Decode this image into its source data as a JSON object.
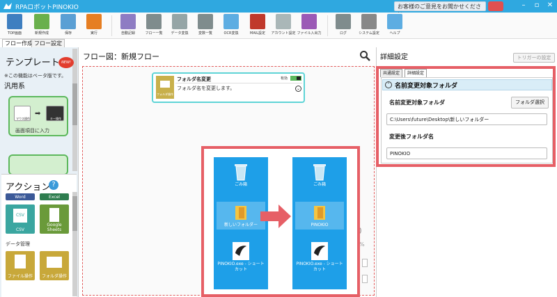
{
  "window": {
    "title": "RPAロボットPINOKIO",
    "feedback": "お客様のご意見をお聞かせください"
  },
  "ribbon": [
    {
      "label": "TOP画面",
      "color": "#3f7fc0",
      "icon": "home-icon"
    },
    {
      "label": "新規作成",
      "color": "#6ab04c",
      "icon": "new-file-icon"
    },
    {
      "label": "保存",
      "color": "#5a9fd4",
      "icon": "save-icon"
    },
    {
      "label": "実行",
      "color": "#e67e22",
      "icon": "play-icon"
    },
    {
      "label": "自動記録",
      "color": "#8e7cc3",
      "icon": "record-icon"
    },
    {
      "label": "フロー一覧",
      "color": "#7f8c8d",
      "icon": "list-icon"
    },
    {
      "label": "データ変換",
      "color": "#95a5a6",
      "icon": "database-icon"
    },
    {
      "label": "変数一覧",
      "color": "#7f8c8d",
      "icon": "variable-list-icon"
    },
    {
      "label": "OCR変換",
      "color": "#5dade2",
      "icon": "ocr-icon"
    },
    {
      "label": "MAIL設定",
      "color": "#c0392b",
      "icon": "mail-icon"
    },
    {
      "label": "アカウント設定",
      "color": "#aab7b8",
      "icon": "account-icon"
    },
    {
      "label": "ファイル入出力",
      "color": "#9b59b6",
      "icon": "file-io-icon"
    },
    {
      "label": "ログ",
      "color": "#7f8c8d",
      "icon": "log-icon"
    },
    {
      "label": "システム設定",
      "color": "#888888",
      "icon": "gear-icon"
    },
    {
      "label": "ヘルプ",
      "color": "#5dade2",
      "icon": "help-icon"
    }
  ],
  "tabs": {
    "flow_create": "フロー作成",
    "flow_settings": "フロー設定"
  },
  "left": {
    "template_title": "テンプレート",
    "new_badge": "NEW!",
    "beta_note": "※この機能はベータ版です。",
    "general_title": "汎用系",
    "card1_label": "画面項目に入力",
    "card1_sub1": "マウス操作",
    "card1_sub2": "キー操作",
    "action_title": "アクション",
    "action_help": "?",
    "tiles": {
      "word": "Word",
      "excel": "Excel",
      "csv": "CSV",
      "csv_icon": "CSV",
      "gsheets": "Google Sheets"
    },
    "data_mgmt": "データ管理",
    "tiles2": {
      "file_op": "ファイル操作",
      "folder_op": "フォルダ操作"
    }
  },
  "center": {
    "title": "フロー図：新規フロー",
    "node": {
      "icon_label": "フォルダ操作",
      "name": "フォルダ名変更",
      "enabled": "有効",
      "desc": "フォルダ名を変更します。"
    },
    "bg_zero": "0",
    "bg_pct": "%",
    "overlay": {
      "before": {
        "trash": "ごみ箱",
        "folder": "新しいフォルダー",
        "shortcut": "PINOKIO.exe - ショートカット"
      },
      "after": {
        "trash": "ごみ箱",
        "folder": "PINOKIO",
        "shortcut": "PINOKIO.exe - ショートカット"
      }
    }
  },
  "right": {
    "title": "詳細設定",
    "trigger_btn": "トリガーの設定",
    "tab_common": "共通設定",
    "tab_detail": "詳細設定",
    "section_title": "名前変更対象フォルダ",
    "target_label": "名前変更対象フォルダ",
    "select_btn": "フォルダ選択",
    "target_value": "C:\\Users\\future\\Desktop\\新しいフォルダー",
    "new_name_label": "変更後フォルダ名",
    "new_name_value": "PINOKIO"
  },
  "colors": {
    "accent": "#2fa8e0",
    "highlight": "#e65f66",
    "desktop": "#1e9fe8",
    "template_green": "#5cb85c"
  }
}
